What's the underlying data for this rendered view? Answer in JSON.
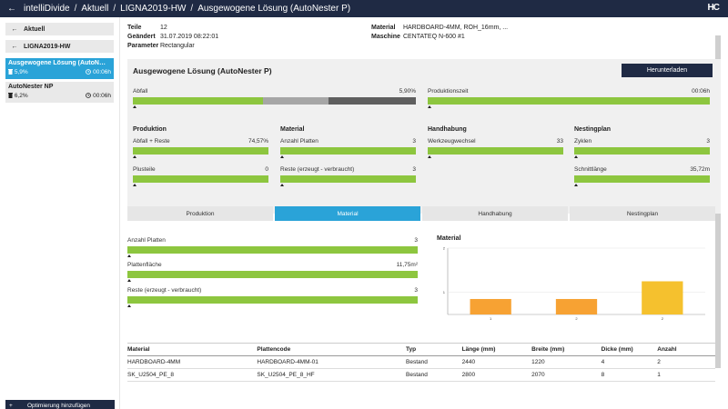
{
  "topbar": {
    "back_icon": "←",
    "app_name": "intelliDivide",
    "sep": "/",
    "crumb1": "Aktuell",
    "crumb2": "LIGNA2019-HW",
    "crumb3": "Ausgewogene Lösung (AutoNester P)",
    "logo": "HC"
  },
  "sidebar": {
    "back1": "Aktuell",
    "back2": "LIGNA2019-HW",
    "solutions": [
      {
        "name": "Ausgewogene Lösung (AutoN…",
        "waste": "5,9%",
        "time": "00:06h"
      },
      {
        "name": "AutoNester NP",
        "waste": "6,2%",
        "time": "00:06h"
      }
    ],
    "add_label": "Optimierung hinzufügen"
  },
  "info": {
    "teile_label": "Teile",
    "teile_value": "12",
    "geaendert_label": "Geändert",
    "geaendert_value": "31.07.2019 08:22:01",
    "parameter_label": "Parameter",
    "parameter_value": "Rectangular",
    "material_label": "Material",
    "material_value": "HARDBOARD-4MM, ROH_16mm, ...",
    "maschine_label": "Maschine",
    "maschine_value": "CENTATEQ N-600 #1"
  },
  "panel": {
    "title": "Ausgewogene Lösung (AutoNester P)",
    "download_label": "Herunterladen",
    "abfall_label": "Abfall",
    "abfall_value": "5,90%",
    "abfall_segments": [
      0.46,
      0.23,
      0.31
    ],
    "produktionszeit_label": "Produktionszeit",
    "produktionszeit_value": "00:06h",
    "sections": {
      "produktion": "Produktion",
      "material": "Material",
      "handhabung": "Handhabung",
      "nestingplan": "Nestingplan"
    },
    "abfall_reste_label": "Abfall + Reste",
    "abfall_reste_value": "74,57%",
    "plusteile_label": "Plusteile",
    "plusteile_value": "0",
    "anzahl_platten_label": "Anzahl Platten",
    "anzahl_platten_value": "3",
    "reste_label": "Reste (erzeugt - verbraucht)",
    "reste_value": "3",
    "werkzeug_label": "Werkzeugwechsel",
    "werkzeug_value": "33",
    "zyklen_label": "Zyklen",
    "zyklen_value": "3",
    "schnitt_label": "Schnittlänge",
    "schnitt_value": "35,72m"
  },
  "tabs": [
    "Produktion",
    "Material",
    "Handhabung",
    "Nestingplan"
  ],
  "material_tab": {
    "anzahl_platten_label": "Anzahl Platten",
    "anzahl_platten_value": "3",
    "plattenflaeche_label": "Plattenfläche",
    "plattenflaeche_value": "11,75m²",
    "reste_label": "Reste (erzeugt - verbraucht)",
    "reste_value": "3"
  },
  "chart_data": {
    "type": "bar",
    "title": "Material",
    "categories": [
      "1",
      "2",
      "2"
    ],
    "values": [
      0.7,
      0.7,
      1.5
    ],
    "colors": [
      "#f7a233",
      "#f7a233",
      "#f5c12e"
    ],
    "ytick_labels": [
      "1",
      "2"
    ],
    "ylim": [
      0,
      3
    ],
    "xlabel": "",
    "ylabel": ""
  },
  "table": {
    "headers": [
      "Material",
      "Plattencode",
      "Typ",
      "Länge (mm)",
      "Breite (mm)",
      "Dicke (mm)",
      "Anzahl"
    ],
    "rows": [
      [
        "HARDBOARD-4MM",
        "HARDBOARD-4MM-01",
        "Bestand",
        "2440",
        "1220",
        "4",
        "2"
      ],
      [
        "SK_U2504_PE_8",
        "SK_U2504_PE_8_HF",
        "Bestand",
        "2800",
        "2070",
        "8",
        "1"
      ]
    ]
  }
}
